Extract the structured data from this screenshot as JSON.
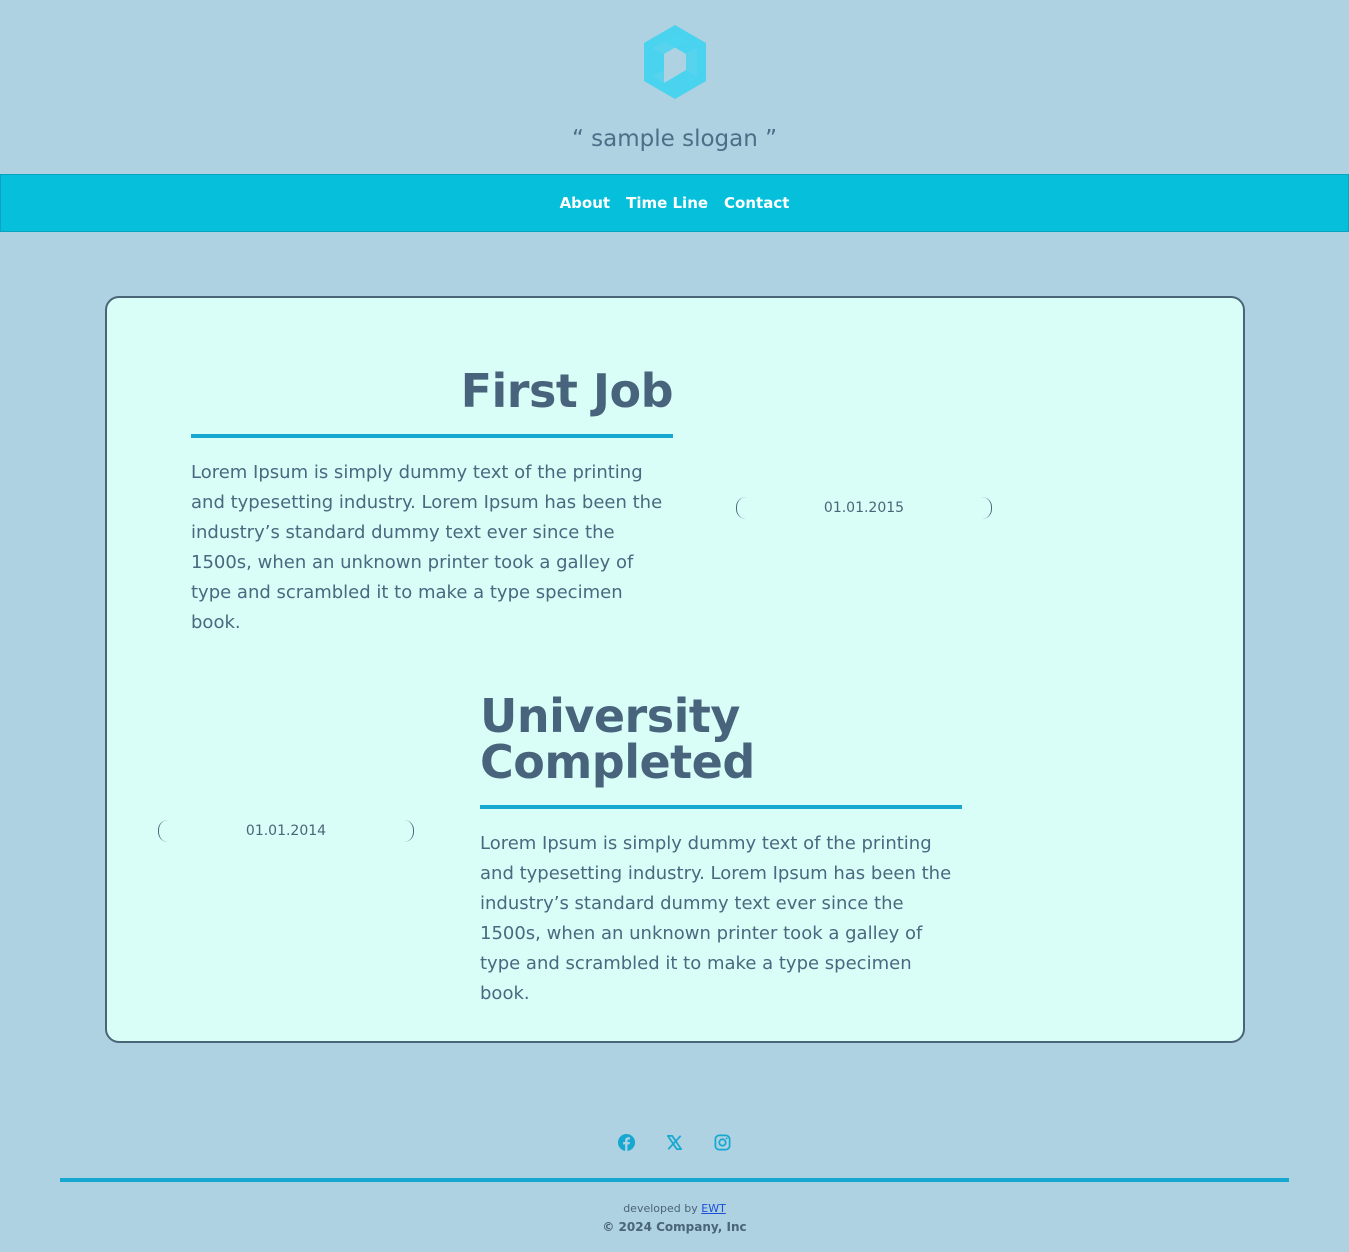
{
  "header": {
    "logo_icon": "hexagon-cube-logo",
    "slogan": "“ sample slogan ”"
  },
  "nav": {
    "items": [
      {
        "label": "About"
      },
      {
        "label": "Time Line"
      },
      {
        "label": "Contact"
      }
    ]
  },
  "timeline": {
    "events": [
      {
        "title": "First Job",
        "text": "Lorem Ipsum is simply dummy text of the printing and typesetting industry. Lorem Ipsum has been the industry’s standard dummy text ever since the 1500s, when an unknown printer took a galley of type and scrambled it to make a type specimen book.",
        "date": "01.01.2015"
      },
      {
        "title": "University Completed",
        "text": "Lorem Ipsum is simply dummy text of the printing and typesetting industry. Lorem Ipsum has been the industry’s standard dummy text ever since the 1500s, when an unknown printer took a galley of type and scrambled it to make a type specimen book.",
        "date": "01.01.2014"
      }
    ]
  },
  "footer": {
    "social": [
      "facebook-icon",
      "x-icon",
      "instagram-icon"
    ],
    "developed_by": "developed by",
    "developer_link": "EWT",
    "copyright": "© 2024 Company, Inc"
  },
  "colors": {
    "background": "#aed2e2",
    "nav_bar": "#05bfdb",
    "card": "#d9fef8",
    "accent_rule": "#16a8d0",
    "text": "#48647c",
    "logo": "#49d3ef"
  }
}
